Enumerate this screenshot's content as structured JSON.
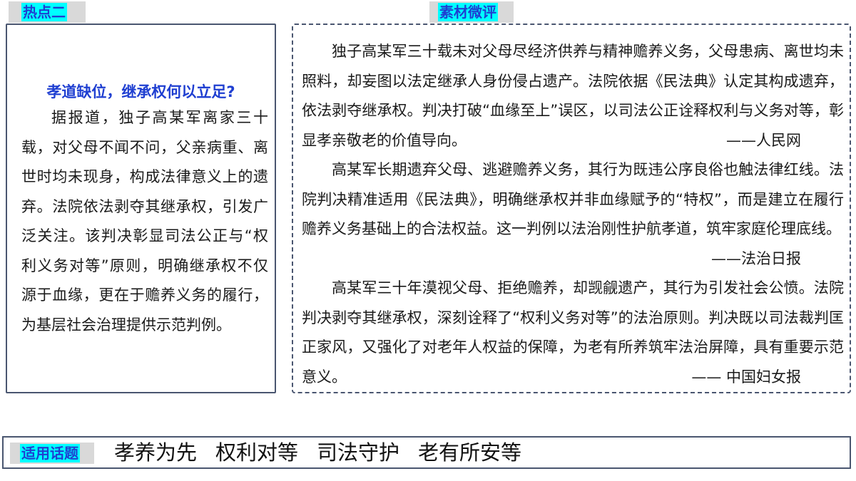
{
  "tabs": {
    "left": "热点二",
    "right": "素材微评"
  },
  "hotspot": {
    "title": "孝道缺位，继承权何以立足?",
    "body": "据报道，独子高某军离家三十载，对父母不闻不问，父亲病重、离世时均未现身，构成法律意义上的遗弃。法院依法剥夺其继承权，引发广泛关注。该判决彰显司法公正与“权利义务对等”原则，明确继承权不仅源于血缘，更在于赡养义务的履行，为基层社会治理提供示范判例。"
  },
  "comments": [
    {
      "text": "独子高某军三十载未对父母尽经济供养与精神赡养义务，父母患病、离世均未照料，却妄图以法定继承人身份侵占遗产。法院依据《民法典》认定其构成遗弃，依法剥夺继承权。判决打破“血缘至上”误区，以司法公正诠释权利与义务对等，彰显孝亲敬老的价值导向。",
      "source": "——人民网"
    },
    {
      "text": "高某军长期遗弃父母、逃避赡养义务，其行为既违公序良俗也触法律红线。法院判决精准适用《民法典》，明确继承权并非血缘赋予的“特权”，而是建立在履行赡养义务基础上的合法权益。这一判例以法治刚性护航孝道，筑牢家庭伦理底线。",
      "source": "——法治日报"
    },
    {
      "text": "高某军三十年漠视父母、拒绝赡养，却觊觎遗产，其行为引发社会公愤。法院判决剥夺其继承权，深刻诠释了“权利义务对等”的法治原则。判决既以司法裁判匡正家风，又强化了对老年人权益的保障，为老有所养筑牢法治屏障，具有重要示范意义。",
      "source": "—— 中国妇女报"
    }
  ],
  "topics": {
    "label": "适用话题",
    "items": [
      "孝养为先",
      "权利对等",
      "司法守护",
      "老有所安等"
    ]
  },
  "colors": {
    "highlight": "#00ffff",
    "accent_text": "#1f3fd1",
    "tab_bg": "#d9d9d9",
    "border": "#4a5670"
  }
}
